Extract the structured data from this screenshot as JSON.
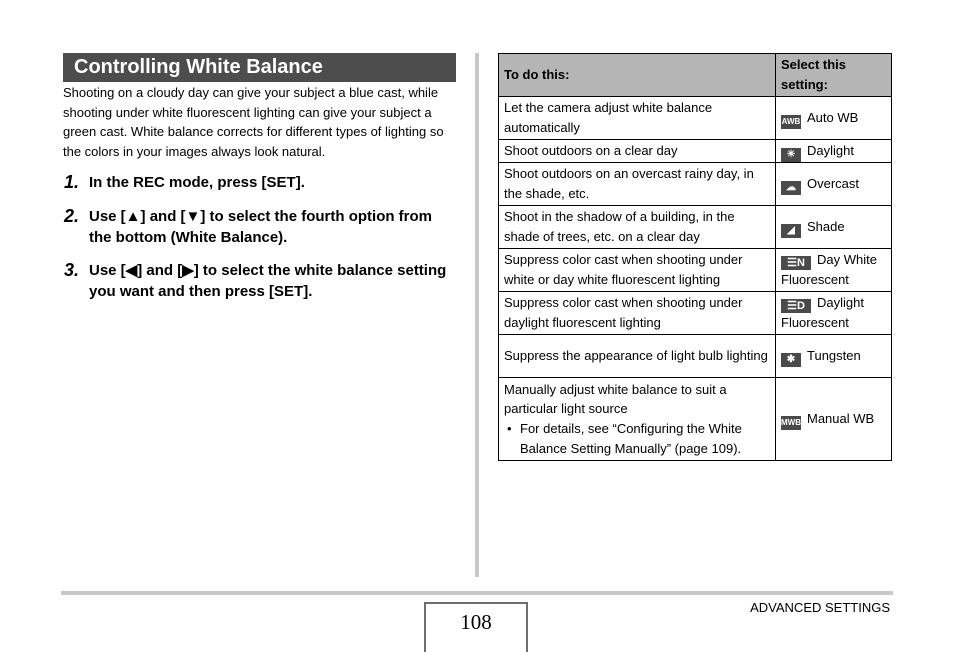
{
  "section": {
    "title": "Controlling White Balance",
    "intro": "Shooting on a cloudy day can give your subject a blue cast, while shooting under white fluorescent lighting can give your subject a green cast. White balance corrects for different types of lighting so the colors in your images always look natural."
  },
  "steps": [
    {
      "num": "1.",
      "text": "In the REC mode, press [SET]."
    },
    {
      "num": "2.",
      "text": "Use [▲] and [▼] to select the fourth option from the bottom (White Balance)."
    },
    {
      "num": "3.",
      "text": "Use [◀] and [▶] to select the white balance setting you want and then press [SET]."
    }
  ],
  "table": {
    "headers": [
      "To do this:",
      "Select this setting:"
    ],
    "rows": [
      {
        "action": "Let the camera adjust white balance automatically",
        "icon": "auto-wb-icon",
        "icon_glyph": "AWB",
        "setting": "Auto WB"
      },
      {
        "action": "Shoot outdoors on a clear day",
        "icon": "daylight-icon",
        "icon_glyph": "☀",
        "setting": "Daylight"
      },
      {
        "action": "Shoot outdoors on an overcast rainy day, in the shade, etc.",
        "icon": "overcast-icon",
        "icon_glyph": "☁",
        "setting": "Overcast"
      },
      {
        "action": "Shoot in the shadow of a building, in the shade of trees, etc. on a clear day",
        "icon": "shade-icon",
        "icon_glyph": "◢",
        "setting": "Shade"
      },
      {
        "action": "Suppress color cast when shooting under white or day white fluorescent lighting",
        "icon": "day-white-fluorescent-icon",
        "icon_glyph": "☰N",
        "setting": "Day White Fluorescent"
      },
      {
        "action": "Suppress color cast when shooting under daylight fluorescent lighting",
        "icon": "daylight-fluorescent-icon",
        "icon_glyph": "☰D",
        "setting": "Daylight Fluorescent"
      },
      {
        "action": "Suppress the appearance of light bulb lighting",
        "icon": "tungsten-icon",
        "icon_glyph": "✱",
        "setting": "Tungsten"
      },
      {
        "action": "Manually adjust white balance to suit a particular light source",
        "note": "For details, see “Configuring the White Balance Setting Manually” (page 109).",
        "icon": "manual-wb-icon",
        "icon_glyph": "MWB",
        "setting": "Manual WB"
      }
    ]
  },
  "footer": {
    "page_number": "108",
    "section_name": "ADVANCED SETTINGS"
  }
}
